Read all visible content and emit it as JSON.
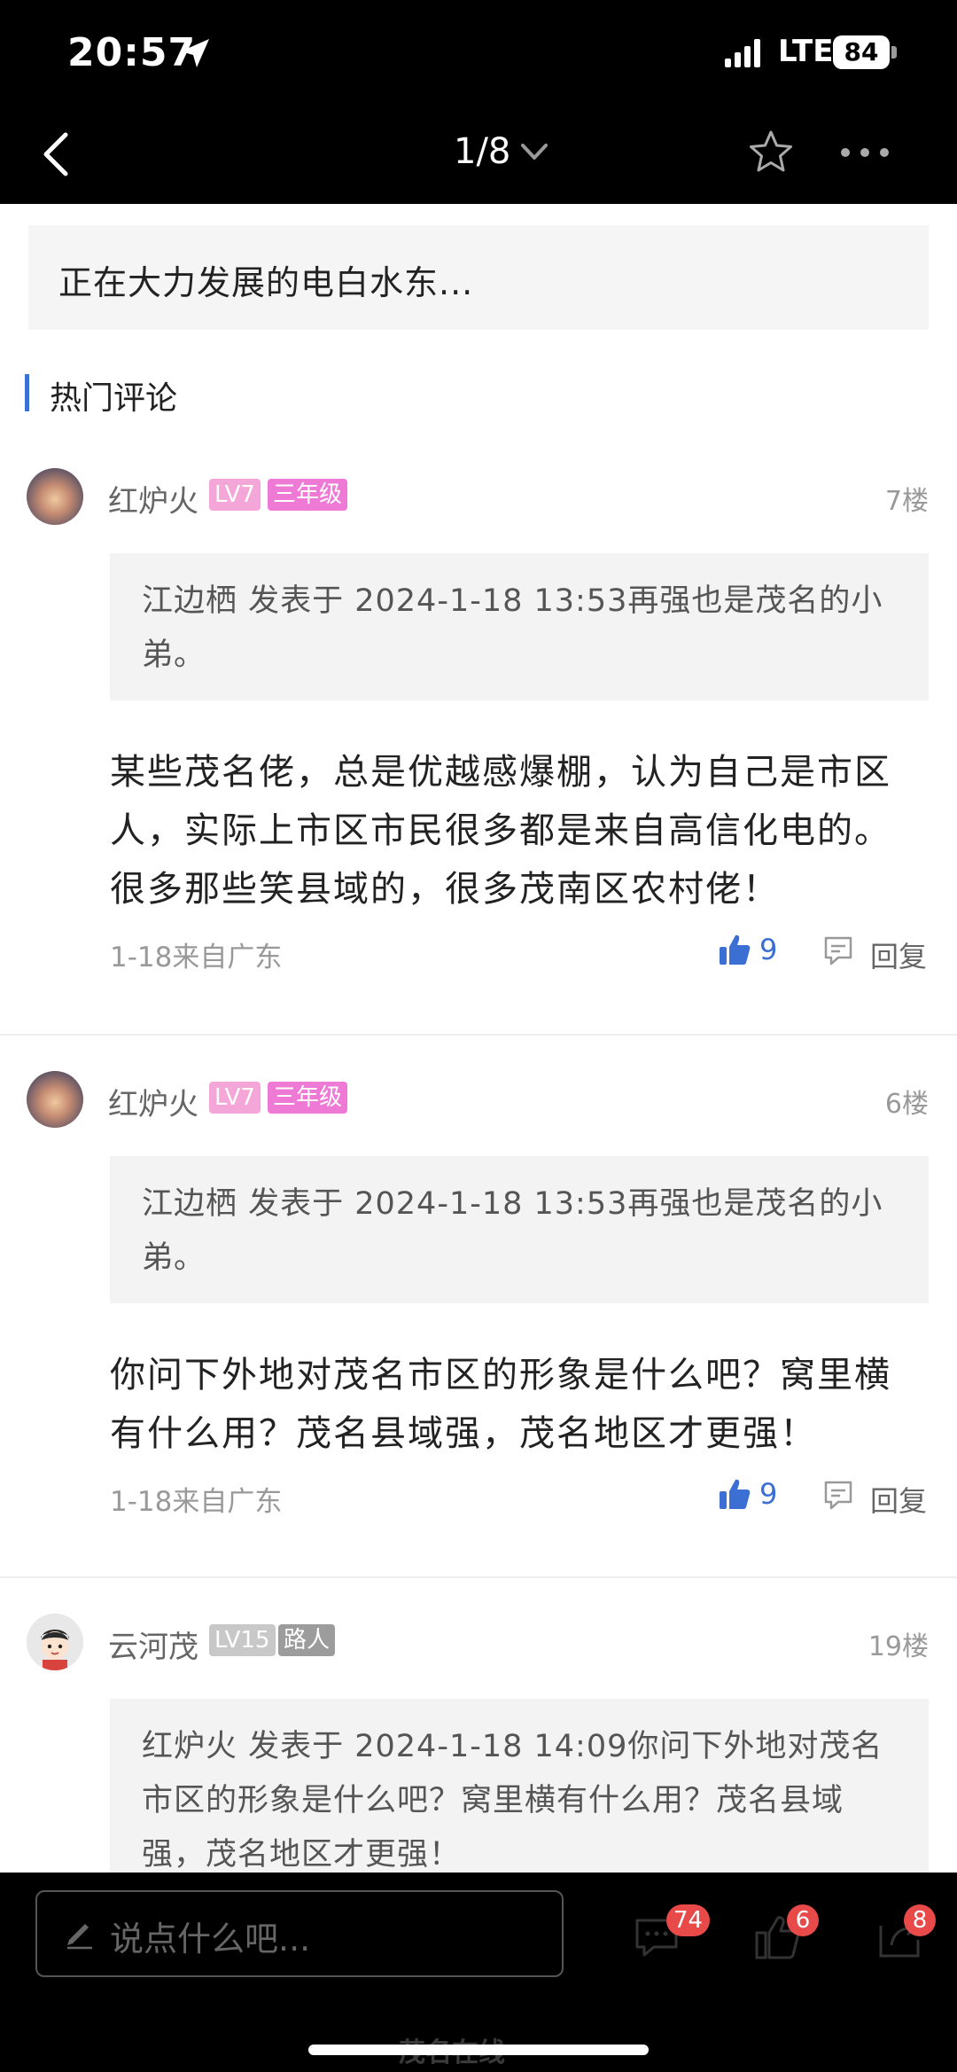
{
  "status_bar": {
    "time": "20:57",
    "network": "LTE",
    "battery": "84"
  },
  "nav": {
    "page_indicator": "1/8"
  },
  "top_quote": {
    "text": "正在大力发展的电白水东..."
  },
  "section": {
    "title": "热门评论"
  },
  "comments": [
    {
      "username": "红炉火",
      "level": "LV7",
      "rank": "三年级",
      "floor": "7楼",
      "quote": "江边栖 发表于 2024-1-18 13:53再强也是茂名的小弟。",
      "body": "某些茂名佬，总是优越感爆棚，认为自己是市区人，实际上市区市民很多都是来自高信化电的。很多那些笑县域的，很多茂南区农村佬！",
      "meta": "1-18来自广东",
      "likes": "9",
      "reply_label": "回复"
    },
    {
      "username": "红炉火",
      "level": "LV7",
      "rank": "三年级",
      "floor": "6楼",
      "quote": "江边栖 发表于 2024-1-18 13:53再强也是茂名的小弟。",
      "body": "你问下外地对茂名市区的形象是什么吧？窝里横有什么用？茂名县域强，茂名地区才更强！",
      "meta": "1-18来自广东",
      "likes": "9",
      "reply_label": "回复"
    },
    {
      "username": "云河茂",
      "level": "LV15",
      "rank": "路人",
      "floor": "19楼",
      "quote": "红炉火 发表于 2024-1-18 14:09你问下外地对茂名市区的形象是什么吧？窝里横有什么用？茂名县域强，茂名地区才更强！"
    }
  ],
  "bottom_bar": {
    "input_placeholder": "说点什么吧...",
    "comment_count": "74",
    "like_count": "6",
    "share_count": "8",
    "watermark": "茂名在线"
  },
  "colors": {
    "accent": "#3b6fd4",
    "badge_red": "#e84a4a",
    "level_pink": "#f4a6d8",
    "rank_pink": "#ee7ad6",
    "level_gray": "#c8c8c8",
    "rank_gray": "#9c9c9c"
  }
}
